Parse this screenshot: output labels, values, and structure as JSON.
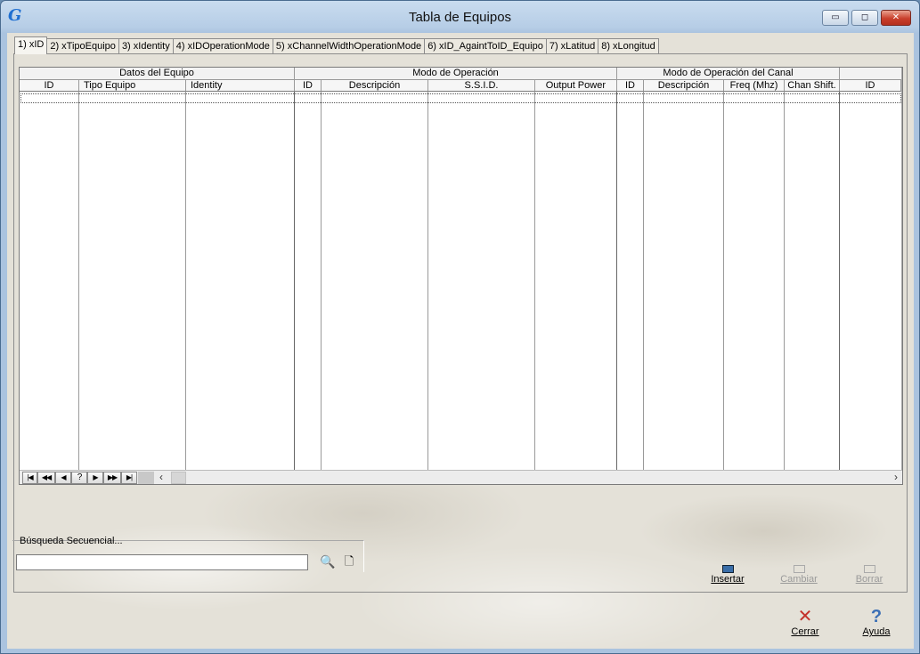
{
  "window": {
    "title": "Tabla de Equipos",
    "app_icon": "G",
    "controls": {
      "minimize": "▭",
      "maximize": "◻",
      "close": "✕"
    }
  },
  "tabs": [
    {
      "label": "1) xID",
      "active": true
    },
    {
      "label": "2) xTipoEquipo"
    },
    {
      "label": "3) xIdentity"
    },
    {
      "label": "4) xIDOperationMode"
    },
    {
      "label": "5) xChannelWidthOperationMode"
    },
    {
      "label": "6) xID_AgaintToID_Equipo"
    },
    {
      "label": "7) xLatitud"
    },
    {
      "label": "8) xLongitud"
    }
  ],
  "grid": {
    "groups": [
      "Datos del Equipo",
      "Modo de Operación",
      "Modo de Operación del Canal",
      ""
    ],
    "columns": [
      "ID",
      "Tipo Equipo",
      "Identity",
      "ID",
      "Descripción",
      "S.S.I.D.",
      "Output Power",
      "ID",
      "Descripción",
      "Freq (Mhz)",
      "Chan Shift.",
      "ID"
    ],
    "nav_buttons": [
      "|◀",
      "◀◀",
      "◀",
      "?",
      "▶",
      "▶▶",
      "▶|"
    ],
    "hscroll": {
      "left": "‹",
      "right": "›"
    }
  },
  "search": {
    "label": "Búsqueda Secuencial...",
    "value": "",
    "search_icon": "🔍",
    "new_icon": "🗋"
  },
  "actions": {
    "insert": "Insertar",
    "change": "Cambiar",
    "delete": "Borrar"
  },
  "footer": {
    "close": "Cerrar",
    "help": "Ayuda",
    "close_icon": "✕",
    "help_icon": "?"
  }
}
